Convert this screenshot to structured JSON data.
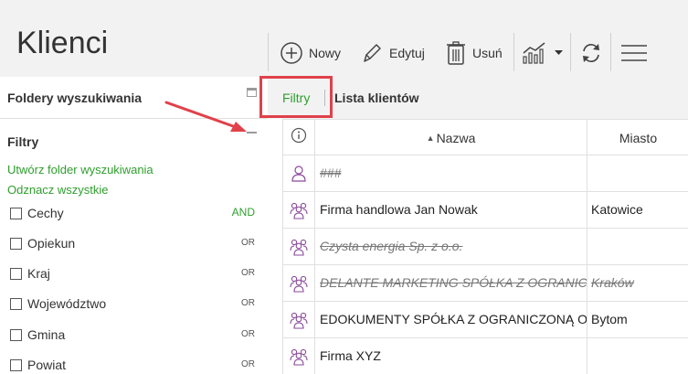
{
  "header": {
    "title": "Klienci",
    "toolbar": {
      "new_label": "Nowy",
      "edit_label": "Edytuj",
      "delete_label": "Usuń"
    }
  },
  "sidebar": {
    "folders_title": "Foldery wyszukiwania",
    "filters_title": "Filtry",
    "create_folder_link": "Utwórz folder wyszukiwania",
    "deselect_all_link": "Odznacz wszystkie",
    "filters": [
      {
        "label": "Cechy",
        "op": "AND"
      },
      {
        "label": "Opiekun",
        "op": "OR"
      },
      {
        "label": "Kraj",
        "op": "OR"
      },
      {
        "label": "Województwo",
        "op": "OR"
      },
      {
        "label": "Gmina",
        "op": "OR"
      },
      {
        "label": "Powiat",
        "op": "OR"
      }
    ]
  },
  "main": {
    "tabs": {
      "filters": "Filtry",
      "client_list": "Lista klientów"
    },
    "columns": {
      "name": "Nazwa",
      "city": "Miasto"
    },
    "rows": [
      {
        "icon": "single-person-icon",
        "name": "###",
        "city": "",
        "struck": true
      },
      {
        "icon": "group-icon",
        "name": "Firma handlowa Jan Nowak",
        "city": "Katowice",
        "struck": false
      },
      {
        "icon": "group-icon",
        "name": "Czysta energia Sp. z o.o.",
        "city": "",
        "struck": true
      },
      {
        "icon": "group-icon",
        "name": "DELANTE MARKETING SPÓŁKA Z OGRANICZONĄ",
        "city": "Kraków",
        "struck": true
      },
      {
        "icon": "group-icon",
        "name": "EDOKUMENTY SPÓŁKA Z OGRANICZONĄ ODPOWIEDZIALNOŚCIĄ",
        "city": "Bytom",
        "struck": false
      },
      {
        "icon": "group-icon",
        "name": "Firma XYZ",
        "city": "",
        "struck": false
      }
    ]
  },
  "colors": {
    "accent_green": "#2e9e2e",
    "highlight_red": "#e0414a",
    "icon_purple": "#8a4a9a"
  }
}
